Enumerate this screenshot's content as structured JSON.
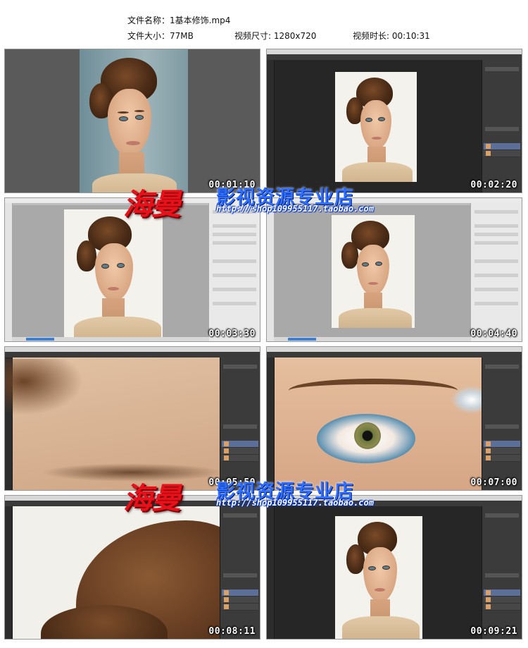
{
  "file_info": {
    "name_label": "文件名称：",
    "name_value": "1基本修饰.mp4",
    "size_label": "文件大小：",
    "size_value": "77MB",
    "resolution_label": "视频尺寸:",
    "resolution_value": "1280x720",
    "duration_label": "视频时长:",
    "duration_value": "00:10:31"
  },
  "thumbnails": [
    {
      "timestamp": "00:01:10"
    },
    {
      "timestamp": "00:02:20"
    },
    {
      "timestamp": "00:03:30"
    },
    {
      "timestamp": "00:04:40"
    },
    {
      "timestamp": "00:05:50"
    },
    {
      "timestamp": "00:07:00"
    },
    {
      "timestamp": "00:08:11"
    },
    {
      "timestamp": "00:09:21"
    }
  ],
  "watermark": {
    "brand": "海曼",
    "shop": "影视资源专业店",
    "url": "http://shop109955117.taobao.com"
  },
  "colors": {
    "watermark_red": "#e8111a",
    "watermark_blue": "#2f6fff",
    "ps_dark": "#262626"
  }
}
